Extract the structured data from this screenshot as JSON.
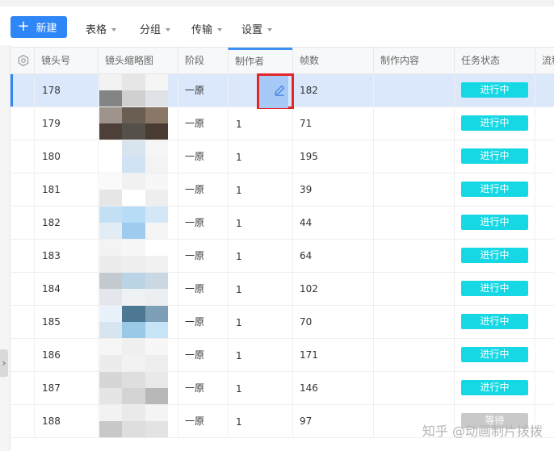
{
  "toolbar": {
    "new_label": "新建",
    "menus": [
      "表格",
      "分组",
      "传输",
      "设置"
    ]
  },
  "table": {
    "columns": [
      "镜头号",
      "镜头缩略图",
      "阶段",
      "制作者",
      "帧数",
      "制作内容",
      "任务状态",
      "流程"
    ],
    "rows": [
      {
        "shot": "178",
        "stage": "一原",
        "maker": "",
        "frames": "182",
        "status": "进行中",
        "selected": true,
        "thumb": [
          "#f2f2f2",
          "#e6e6e6",
          "#f5f5f5",
          "#838486",
          "#d0d0d0",
          "#dfe3e8"
        ]
      },
      {
        "shot": "179",
        "stage": "一原",
        "maker": "1",
        "frames": "71",
        "status": "进行中",
        "thumb": [
          "#9e948c",
          "#6a5d52",
          "#8b7766",
          "#4c4038",
          "#56504b",
          "#4a3c33"
        ]
      },
      {
        "shot": "180",
        "stage": "一原",
        "maker": "1",
        "frames": "195",
        "status": "进行中",
        "thumb": [
          "#ffffff",
          "#d8e5ef",
          "#f6f6f6",
          "#ffffff",
          "#cfe3f5",
          "#f3f3f3"
        ]
      },
      {
        "shot": "181",
        "stage": "一原",
        "maker": "1",
        "frames": "39",
        "status": "进行中",
        "thumb": [
          "#fafafa",
          "#f1f1f1",
          "#f7f7f7",
          "#e6e6e6",
          "#ffffff",
          "#eeeeee"
        ]
      },
      {
        "shot": "182",
        "stage": "一原",
        "maker": "1",
        "frames": "44",
        "status": "进行中",
        "thumb": [
          "#c2dff3",
          "#b6dcf6",
          "#d4e7f7",
          "#e2ecf4",
          "#9fcbee",
          "#f5f5f5"
        ]
      },
      {
        "shot": "183",
        "stage": "一原",
        "maker": "1",
        "frames": "64",
        "status": "进行中",
        "thumb": [
          "#f3f3f3",
          "#f7f7f7",
          "#ffffff",
          "#ececec",
          "#eeeeee",
          "#f1f1f1"
        ]
      },
      {
        "shot": "184",
        "stage": "一原",
        "maker": "1",
        "frames": "102",
        "status": "进行中",
        "thumb": [
          "#c3c9ce",
          "#bad4e6",
          "#c9d8e2",
          "#e3e6ea",
          "#eef2f5",
          "#eceff2"
        ]
      },
      {
        "shot": "185",
        "stage": "一原",
        "maker": "1",
        "frames": "70",
        "status": "进行中",
        "thumb": [
          "#e9f1fa",
          "#4d7893",
          "#7d9fb7",
          "#d7e5f0",
          "#9ac9e8",
          "#c7e3f6"
        ]
      },
      {
        "shot": "186",
        "stage": "一原",
        "maker": "1",
        "frames": "171",
        "status": "进行中",
        "thumb": [
          "#f6f6f6",
          "#f0f0f0",
          "#f7f7f7",
          "#ececec",
          "#f2f2f2",
          "#eeeeee"
        ]
      },
      {
        "shot": "187",
        "stage": "一原",
        "maker": "1",
        "frames": "146",
        "status": "进行中",
        "thumb": [
          "#d6d6d6",
          "#dedede",
          "#e9e9e9",
          "#e5e5e5",
          "#d4d4d4",
          "#b8b8b8"
        ]
      },
      {
        "shot": "188",
        "stage": "一原",
        "maker": "1",
        "frames": "97",
        "status": "等待",
        "thumb": [
          "#f2f2f2",
          "#eaeaea",
          "#f4f4f4",
          "#c8c8c8",
          "#dedede",
          "#e3e3e3"
        ]
      }
    ]
  },
  "watermark": "知乎 @动画制片拨拨",
  "colors": {
    "accent": "#2f86f6",
    "status_active": "#16d8e4",
    "status_wait": "#c9c9c9",
    "highlight": "#e3262b"
  }
}
